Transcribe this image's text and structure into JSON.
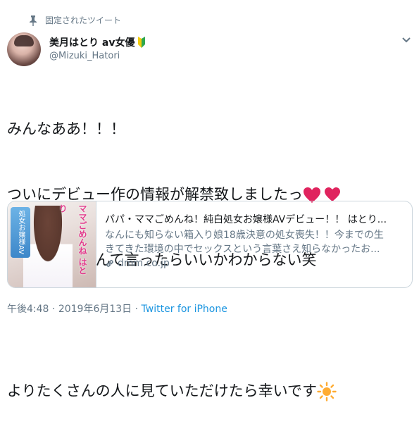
{
  "pinned": {
    "label": "固定されたツイート"
  },
  "user": {
    "display_name": "美月はとり av女優",
    "handle": "@Mizuki_Hatori"
  },
  "tweet": {
    "line1": "みんなああ！！！",
    "line2": "ついにデビュー作の情報が解禁致しましたっ",
    "line3": "嬉しすぎてなんて言ったらいいかわからない笑",
    "line5": "よりたくさんの人に見ていただけたら幸いです"
  },
  "card": {
    "title": "パパ・ママごめんね！純白処女お嬢様AVデビュー！！ はとり...",
    "desc_line1": "なんにも知らない箱入り娘18歳決意の処女喪失！！今までの生",
    "desc_line2": "きてきた環境の中でセックスという言葉さえ知らなかったお...",
    "domain": "dmm.co.jp",
    "thumb_left": "処女お嬢様AVデビュー",
    "thumb_right": "ママごめんね はとり"
  },
  "meta": {
    "time": "午後4:48",
    "separator": " · ",
    "date": "2019年6月13日",
    "separator2": " · ",
    "source": "Twitter for iPhone"
  },
  "colors": {
    "text": "#14171a",
    "secondary": "#657786",
    "link": "#1b95e0",
    "heart": "#e0245e",
    "sun": "#ffac33"
  }
}
